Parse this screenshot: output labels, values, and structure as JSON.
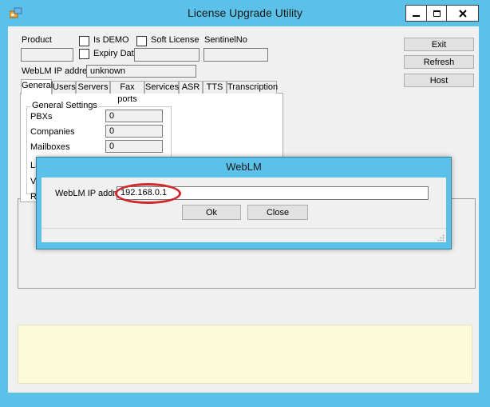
{
  "window": {
    "title": "License Upgrade Utility",
    "caption_buttons": {
      "minimize": "_",
      "maximize": "□",
      "close": "x"
    }
  },
  "form": {
    "product_label": "Product",
    "product_value": "",
    "is_demo_label": "Is DEMO",
    "is_demo_checked": false,
    "soft_license_label": "Soft License",
    "soft_license_checked": false,
    "sentinel_label": "SentinelNo",
    "sentinel_value": "",
    "expiry_label": "Expiry Date",
    "expiry_checked": false,
    "expiry_value": "",
    "weblm_label": "WebLM IP address",
    "weblm_value": "unknown"
  },
  "buttons": {
    "exit": "Exit",
    "refresh": "Refresh",
    "host": "Host"
  },
  "tabs": [
    {
      "label": "General",
      "active": true
    },
    {
      "label": "Users",
      "active": false
    },
    {
      "label": "Servers",
      "active": false
    },
    {
      "label": "Fax ports",
      "active": false
    },
    {
      "label": "Services",
      "active": false
    },
    {
      "label": "ASR",
      "active": false
    },
    {
      "label": "TTS",
      "active": false
    },
    {
      "label": "Transcription",
      "active": false
    }
  ],
  "general": {
    "group_title": "General Settings",
    "fields": [
      {
        "label": "PBXs",
        "value": "0"
      },
      {
        "label": "Companies",
        "value": "0"
      },
      {
        "label": "Mailboxes",
        "value": "0"
      },
      {
        "label": "La",
        "value": ""
      },
      {
        "label": "Vo",
        "value": ""
      },
      {
        "label": "Re",
        "value": ""
      }
    ]
  },
  "dialog": {
    "title": "WebLM",
    "ip_label": "WebLM IP address",
    "ip_value": "192.168.0.1",
    "ok_label": "Ok",
    "close_label": "Close",
    "highlight_color": "#d0282a"
  },
  "colors": {
    "accent": "#5cc1e8",
    "notes_background": "#fbfbda"
  }
}
